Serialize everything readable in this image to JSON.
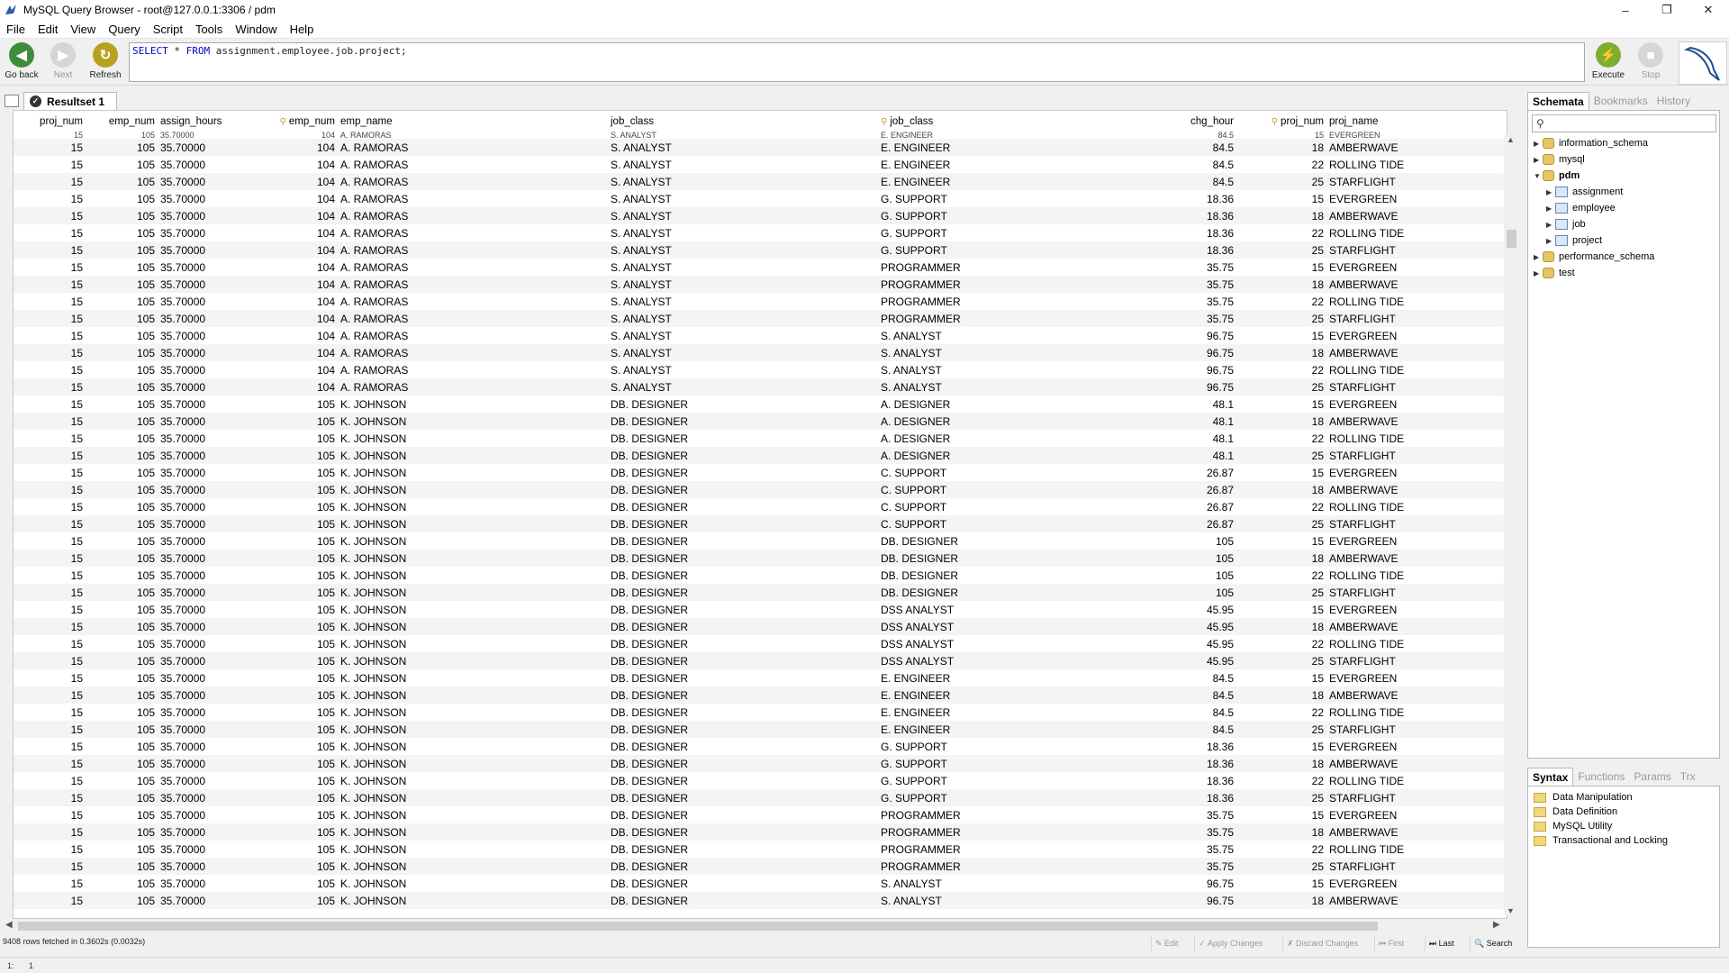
{
  "window": {
    "title": "MySQL Query Browser - root@127.0.0.1:3306 / pdm",
    "controls": [
      "minimize-icon",
      "restore-icon",
      "close-icon"
    ]
  },
  "menu": [
    "File",
    "Edit",
    "View",
    "Query",
    "Script",
    "Tools",
    "Window",
    "Help"
  ],
  "toolbar": {
    "go_back": "Go back",
    "next": "Next",
    "refresh": "Refresh",
    "execute": "Execute",
    "stop": "Stop"
  },
  "query": {
    "keyword1": "SELECT",
    "star": " * ",
    "keyword2": "FROM",
    "rest": " assignment.employee.job.project;"
  },
  "resultset": {
    "tab_label": "Resultset 1"
  },
  "grid": {
    "columns": [
      "proj_num",
      "emp_num",
      "assign_hours",
      "emp_num",
      "emp_name",
      "job_class",
      "job_class",
      "chg_hour",
      "proj_num",
      "proj_name"
    ],
    "clipped_row": [
      "15",
      "105",
      "35.70000",
      "104",
      "A. RAMORAS",
      "S. ANALYST",
      "E. ENGINEER",
      "84.5",
      "15",
      "EVERGREEN"
    ],
    "rows": [
      [
        "15",
        "105",
        "35.70000",
        "104",
        "A. RAMORAS",
        "S. ANALYST",
        "E. ENGINEER",
        "84.5",
        "18",
        "AMBERWAVE"
      ],
      [
        "15",
        "105",
        "35.70000",
        "104",
        "A. RAMORAS",
        "S. ANALYST",
        "E. ENGINEER",
        "84.5",
        "22",
        "ROLLING TIDE"
      ],
      [
        "15",
        "105",
        "35.70000",
        "104",
        "A. RAMORAS",
        "S. ANALYST",
        "E. ENGINEER",
        "84.5",
        "25",
        "STARFLIGHT"
      ],
      [
        "15",
        "105",
        "35.70000",
        "104",
        "A. RAMORAS",
        "S. ANALYST",
        "G. SUPPORT",
        "18.36",
        "15",
        "EVERGREEN"
      ],
      [
        "15",
        "105",
        "35.70000",
        "104",
        "A. RAMORAS",
        "S. ANALYST",
        "G. SUPPORT",
        "18.36",
        "18",
        "AMBERWAVE"
      ],
      [
        "15",
        "105",
        "35.70000",
        "104",
        "A. RAMORAS",
        "S. ANALYST",
        "G. SUPPORT",
        "18.36",
        "22",
        "ROLLING TIDE"
      ],
      [
        "15",
        "105",
        "35.70000",
        "104",
        "A. RAMORAS",
        "S. ANALYST",
        "G. SUPPORT",
        "18.36",
        "25",
        "STARFLIGHT"
      ],
      [
        "15",
        "105",
        "35.70000",
        "104",
        "A. RAMORAS",
        "S. ANALYST",
        "PROGRAMMER",
        "35.75",
        "15",
        "EVERGREEN"
      ],
      [
        "15",
        "105",
        "35.70000",
        "104",
        "A. RAMORAS",
        "S. ANALYST",
        "PROGRAMMER",
        "35.75",
        "18",
        "AMBERWAVE"
      ],
      [
        "15",
        "105",
        "35.70000",
        "104",
        "A. RAMORAS",
        "S. ANALYST",
        "PROGRAMMER",
        "35.75",
        "22",
        "ROLLING TIDE"
      ],
      [
        "15",
        "105",
        "35.70000",
        "104",
        "A. RAMORAS",
        "S. ANALYST",
        "PROGRAMMER",
        "35.75",
        "25",
        "STARFLIGHT"
      ],
      [
        "15",
        "105",
        "35.70000",
        "104",
        "A. RAMORAS",
        "S. ANALYST",
        "S. ANALYST",
        "96.75",
        "15",
        "EVERGREEN"
      ],
      [
        "15",
        "105",
        "35.70000",
        "104",
        "A. RAMORAS",
        "S. ANALYST",
        "S. ANALYST",
        "96.75",
        "18",
        "AMBERWAVE"
      ],
      [
        "15",
        "105",
        "35.70000",
        "104",
        "A. RAMORAS",
        "S. ANALYST",
        "S. ANALYST",
        "96.75",
        "22",
        "ROLLING TIDE"
      ],
      [
        "15",
        "105",
        "35.70000",
        "104",
        "A. RAMORAS",
        "S. ANALYST",
        "S. ANALYST",
        "96.75",
        "25",
        "STARFLIGHT"
      ],
      [
        "15",
        "105",
        "35.70000",
        "105",
        "K. JOHNSON",
        "DB. DESIGNER",
        "A. DESIGNER",
        "48.1",
        "15",
        "EVERGREEN"
      ],
      [
        "15",
        "105",
        "35.70000",
        "105",
        "K. JOHNSON",
        "DB. DESIGNER",
        "A. DESIGNER",
        "48.1",
        "18",
        "AMBERWAVE"
      ],
      [
        "15",
        "105",
        "35.70000",
        "105",
        "K. JOHNSON",
        "DB. DESIGNER",
        "A. DESIGNER",
        "48.1",
        "22",
        "ROLLING TIDE"
      ],
      [
        "15",
        "105",
        "35.70000",
        "105",
        "K. JOHNSON",
        "DB. DESIGNER",
        "A. DESIGNER",
        "48.1",
        "25",
        "STARFLIGHT"
      ],
      [
        "15",
        "105",
        "35.70000",
        "105",
        "K. JOHNSON",
        "DB. DESIGNER",
        "C. SUPPORT",
        "26.87",
        "15",
        "EVERGREEN"
      ],
      [
        "15",
        "105",
        "35.70000",
        "105",
        "K. JOHNSON",
        "DB. DESIGNER",
        "C. SUPPORT",
        "26.87",
        "18",
        "AMBERWAVE"
      ],
      [
        "15",
        "105",
        "35.70000",
        "105",
        "K. JOHNSON",
        "DB. DESIGNER",
        "C. SUPPORT",
        "26.87",
        "22",
        "ROLLING TIDE"
      ],
      [
        "15",
        "105",
        "35.70000",
        "105",
        "K. JOHNSON",
        "DB. DESIGNER",
        "C. SUPPORT",
        "26.87",
        "25",
        "STARFLIGHT"
      ],
      [
        "15",
        "105",
        "35.70000",
        "105",
        "K. JOHNSON",
        "DB. DESIGNER",
        "DB. DESIGNER",
        "105",
        "15",
        "EVERGREEN"
      ],
      [
        "15",
        "105",
        "35.70000",
        "105",
        "K. JOHNSON",
        "DB. DESIGNER",
        "DB. DESIGNER",
        "105",
        "18",
        "AMBERWAVE"
      ],
      [
        "15",
        "105",
        "35.70000",
        "105",
        "K. JOHNSON",
        "DB. DESIGNER",
        "DB. DESIGNER",
        "105",
        "22",
        "ROLLING TIDE"
      ],
      [
        "15",
        "105",
        "35.70000",
        "105",
        "K. JOHNSON",
        "DB. DESIGNER",
        "DB. DESIGNER",
        "105",
        "25",
        "STARFLIGHT"
      ],
      [
        "15",
        "105",
        "35.70000",
        "105",
        "K. JOHNSON",
        "DB. DESIGNER",
        "DSS ANALYST",
        "45.95",
        "15",
        "EVERGREEN"
      ],
      [
        "15",
        "105",
        "35.70000",
        "105",
        "K. JOHNSON",
        "DB. DESIGNER",
        "DSS ANALYST",
        "45.95",
        "18",
        "AMBERWAVE"
      ],
      [
        "15",
        "105",
        "35.70000",
        "105",
        "K. JOHNSON",
        "DB. DESIGNER",
        "DSS ANALYST",
        "45.95",
        "22",
        "ROLLING TIDE"
      ],
      [
        "15",
        "105",
        "35.70000",
        "105",
        "K. JOHNSON",
        "DB. DESIGNER",
        "DSS ANALYST",
        "45.95",
        "25",
        "STARFLIGHT"
      ],
      [
        "15",
        "105",
        "35.70000",
        "105",
        "K. JOHNSON",
        "DB. DESIGNER",
        "E. ENGINEER",
        "84.5",
        "15",
        "EVERGREEN"
      ],
      [
        "15",
        "105",
        "35.70000",
        "105",
        "K. JOHNSON",
        "DB. DESIGNER",
        "E. ENGINEER",
        "84.5",
        "18",
        "AMBERWAVE"
      ],
      [
        "15",
        "105",
        "35.70000",
        "105",
        "K. JOHNSON",
        "DB. DESIGNER",
        "E. ENGINEER",
        "84.5",
        "22",
        "ROLLING TIDE"
      ],
      [
        "15",
        "105",
        "35.70000",
        "105",
        "K. JOHNSON",
        "DB. DESIGNER",
        "E. ENGINEER",
        "84.5",
        "25",
        "STARFLIGHT"
      ],
      [
        "15",
        "105",
        "35.70000",
        "105",
        "K. JOHNSON",
        "DB. DESIGNER",
        "G. SUPPORT",
        "18.36",
        "15",
        "EVERGREEN"
      ],
      [
        "15",
        "105",
        "35.70000",
        "105",
        "K. JOHNSON",
        "DB. DESIGNER",
        "G. SUPPORT",
        "18.36",
        "18",
        "AMBERWAVE"
      ],
      [
        "15",
        "105",
        "35.70000",
        "105",
        "K. JOHNSON",
        "DB. DESIGNER",
        "G. SUPPORT",
        "18.36",
        "22",
        "ROLLING TIDE"
      ],
      [
        "15",
        "105",
        "35.70000",
        "105",
        "K. JOHNSON",
        "DB. DESIGNER",
        "G. SUPPORT",
        "18.36",
        "25",
        "STARFLIGHT"
      ],
      [
        "15",
        "105",
        "35.70000",
        "105",
        "K. JOHNSON",
        "DB. DESIGNER",
        "PROGRAMMER",
        "35.75",
        "15",
        "EVERGREEN"
      ],
      [
        "15",
        "105",
        "35.70000",
        "105",
        "K. JOHNSON",
        "DB. DESIGNER",
        "PROGRAMMER",
        "35.75",
        "18",
        "AMBERWAVE"
      ],
      [
        "15",
        "105",
        "35.70000",
        "105",
        "K. JOHNSON",
        "DB. DESIGNER",
        "PROGRAMMER",
        "35.75",
        "22",
        "ROLLING TIDE"
      ],
      [
        "15",
        "105",
        "35.70000",
        "105",
        "K. JOHNSON",
        "DB. DESIGNER",
        "PROGRAMMER",
        "35.75",
        "25",
        "STARFLIGHT"
      ],
      [
        "15",
        "105",
        "35.70000",
        "105",
        "K. JOHNSON",
        "DB. DESIGNER",
        "S. ANALYST",
        "96.75",
        "15",
        "EVERGREEN"
      ],
      [
        "15",
        "105",
        "35.70000",
        "105",
        "K. JOHNSON",
        "DB. DESIGNER",
        "S. ANALYST",
        "96.75",
        "18",
        "AMBERWAVE"
      ]
    ]
  },
  "status": {
    "rows_fetched": "9408 rows fetched in 0.3602s (0.0032s)",
    "edit": "Edit",
    "apply": "Apply Changes",
    "discard": "Discard Changes",
    "first": "First",
    "last": "Last",
    "search": "Search"
  },
  "bottombar": {
    "line": "1:",
    "col": "1"
  },
  "sidepanel": {
    "tabs": [
      "Schemata",
      "Bookmarks",
      "History"
    ],
    "tree": [
      {
        "label": "information_schema",
        "type": "db",
        "level": 0
      },
      {
        "label": "mysql",
        "type": "db",
        "level": 0
      },
      {
        "label": "pdm",
        "type": "db",
        "level": 0,
        "expanded": true
      },
      {
        "label": "assignment",
        "type": "table",
        "level": 1
      },
      {
        "label": "employee",
        "type": "table",
        "level": 1
      },
      {
        "label": "job",
        "type": "table",
        "level": 1
      },
      {
        "label": "project",
        "type": "table",
        "level": 1
      },
      {
        "label": "performance_schema",
        "type": "db",
        "level": 0
      },
      {
        "label": "test",
        "type": "db",
        "level": 0
      }
    ]
  },
  "syntax": {
    "tabs": [
      "Syntax",
      "Functions",
      "Params",
      "Trx"
    ],
    "items": [
      "Data Manipulation",
      "Data Definition",
      "MySQL Utility",
      "Transactional and Locking"
    ]
  },
  "colors": {
    "execute": "#f0a800",
    "back": "#3c8c3c",
    "refresh": "#d0a000",
    "keyword": "#0000cc"
  }
}
